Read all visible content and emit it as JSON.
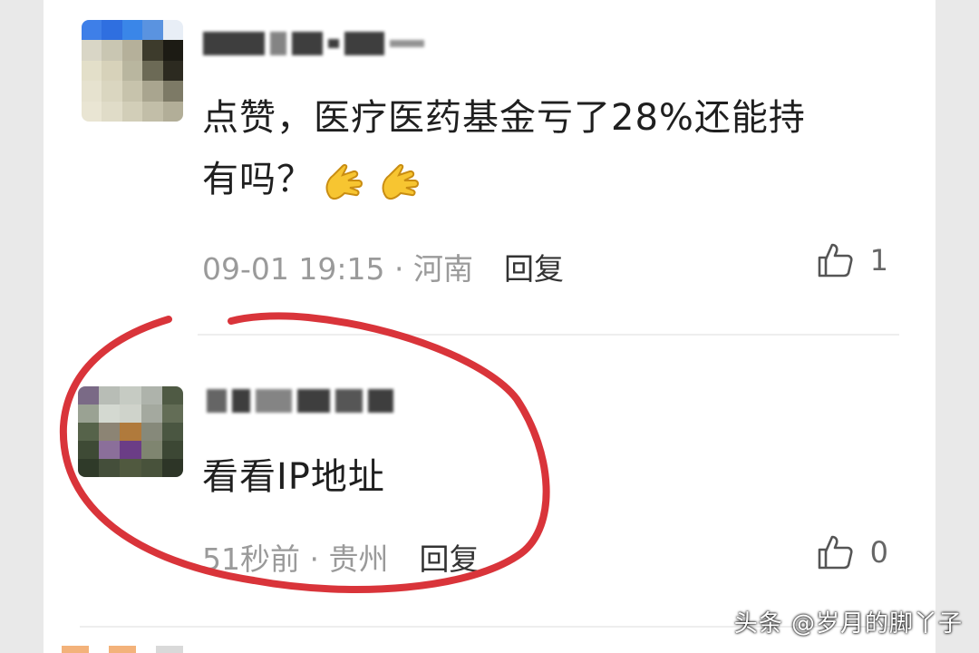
{
  "comments": [
    {
      "text_line1": "点赞，医疗医药基金亏了28%还能持",
      "text_line2": "有吗？",
      "emoji_icon": "folded-hands-emoji",
      "time_location": "09-01 19:15 · 河南",
      "reply_label": "回复",
      "like_count": "1"
    },
    {
      "text": "看看IP地址",
      "time_location": "51秒前 · 贵州",
      "reply_label": "回复",
      "like_count": "0"
    }
  ],
  "watermark": "头条 @岁月的脚丫子",
  "annotation_color": "#d9343a"
}
